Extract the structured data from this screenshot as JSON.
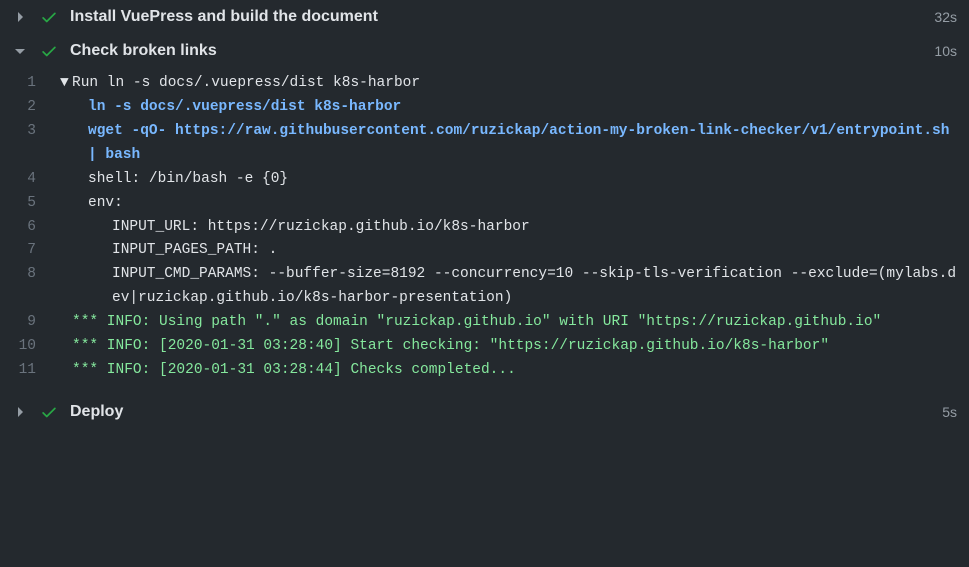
{
  "steps": [
    {
      "title": "Install VuePress and build the document",
      "time": "32s"
    },
    {
      "title": "Check broken links",
      "time": "10s"
    },
    {
      "title": "Deploy",
      "time": "5s"
    }
  ],
  "log": {
    "l1": "Run ln -s docs/.vuepress/dist k8s-harbor",
    "l2": "ln -s docs/.vuepress/dist k8s-harbor",
    "l3": "wget -qO- https://raw.githubusercontent.com/ruzickap/action-my-broken-link-checker/v1/entrypoint.sh | bash",
    "l4": "shell: /bin/bash -e {0}",
    "l5": "env:",
    "l6": "INPUT_URL: https://ruzickap.github.io/k8s-harbor",
    "l7": "INPUT_PAGES_PATH: .",
    "l8": "INPUT_CMD_PARAMS: --buffer-size=8192 --concurrency=10 --skip-tls-verification --exclude=(mylabs.dev|ruzickap.github.io/k8s-harbor-presentation)",
    "l9": "*** INFO: Using path \".\" as domain \"ruzickap.github.io\" with URI \"https://ruzickap.github.io\"",
    "l10": "*** INFO: [2020-01-31 03:28:40] Start checking: \"https://ruzickap.github.io/k8s-harbor\"",
    "l11": "*** INFO: [2020-01-31 03:28:44] Checks completed..."
  },
  "lineNumbers": {
    "n1": "1",
    "n2": "2",
    "n3": "3",
    "n4": "4",
    "n5": "5",
    "n6": "6",
    "n7": "7",
    "n8": "8",
    "n9": "9",
    "n10": "10",
    "n11": "11"
  }
}
